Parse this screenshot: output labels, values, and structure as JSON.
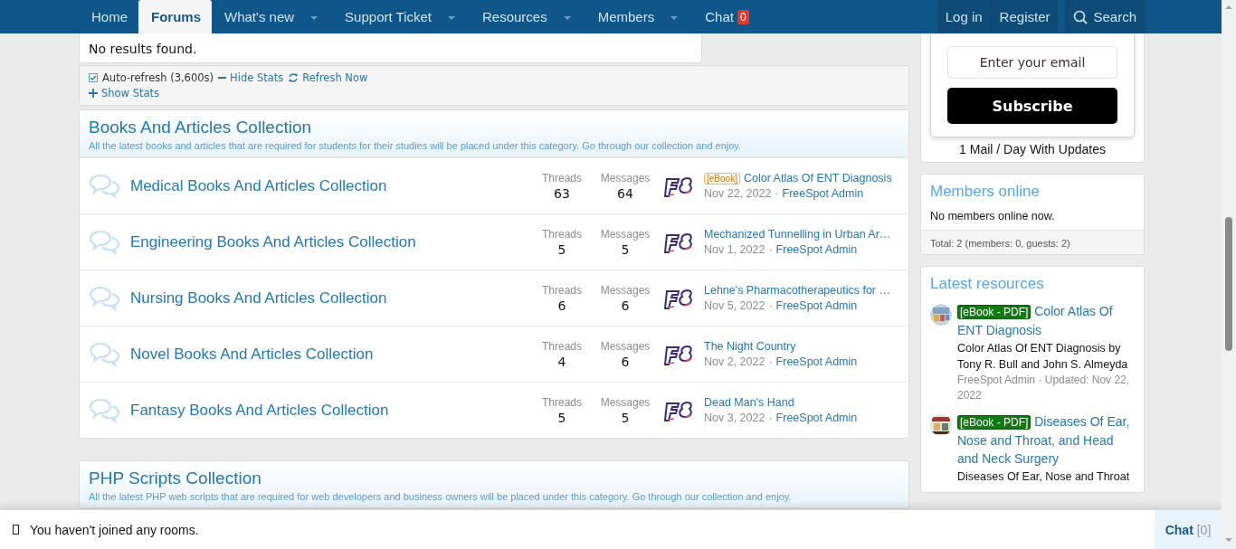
{
  "nav": {
    "tabs": [
      {
        "label": "Home",
        "selected": false,
        "dropdown": false
      },
      {
        "label": "Forums",
        "selected": true,
        "dropdown": false
      },
      {
        "label": "What's new",
        "selected": false,
        "dropdown": true
      },
      {
        "label": "Support Ticket",
        "selected": false,
        "dropdown": true
      },
      {
        "label": "Resources",
        "selected": false,
        "dropdown": true
      },
      {
        "label": "Members",
        "selected": false,
        "dropdown": true
      },
      {
        "label": "Chat",
        "selected": false,
        "dropdown": false,
        "badge": "0"
      }
    ],
    "account": [
      "Log in",
      "Register"
    ],
    "search": "Search"
  },
  "results": "No results found.",
  "stats": {
    "auto_refresh": {
      "label": "Auto-refresh (3,600s)",
      "checked": true
    },
    "hide": "Hide Stats",
    "refresh": "Refresh Now",
    "show": "Show Stats"
  },
  "categories": [
    {
      "title": "Books And Articles Collection",
      "description": "All the latest books and articles that are required for students for their studies will be placed under this category. Go through our collection and enjoy.",
      "forums": [
        {
          "name": "Medical Books And Articles Collection",
          "threads_label": "Threads",
          "threads": "63",
          "messages_label": "Messages",
          "messages": "64",
          "prefix": "[eBook]",
          "latest": "Color Atlas Of ENT Diagnosis",
          "date": "Nov 22, 2022",
          "separator": "·",
          "author": "FreeSpot Admin"
        },
        {
          "name": "Engineering Books And Articles Collection",
          "threads_label": "Threads",
          "threads": "5",
          "messages_label": "Messages",
          "messages": "5",
          "latest": "Mechanized Tunnelling in Urban Ar…",
          "date": "Nov 1, 2022",
          "separator": "·",
          "author": "FreeSpot Admin"
        },
        {
          "name": "Nursing Books And Articles Collection",
          "threads_label": "Threads",
          "threads": "6",
          "messages_label": "Messages",
          "messages": "6",
          "latest": "Lehne's Pharmacotherapeutics for …",
          "date": "Nov 5, 2022",
          "separator": "·",
          "author": "FreeSpot Admin"
        },
        {
          "name": "Novel Books And Articles Collection",
          "threads_label": "Threads",
          "threads": "4",
          "messages_label": "Messages",
          "messages": "6",
          "latest": "The Night Country",
          "date": "Nov 2, 2022",
          "separator": "·",
          "author": "FreeSpot Admin"
        },
        {
          "name": "Fantasy Books And Articles Collection",
          "threads_label": "Threads",
          "threads": "5",
          "messages_label": "Messages",
          "messages": "5",
          "latest": "Dead Man's Hand",
          "date": "Nov 3, 2022",
          "separator": "·",
          "author": "FreeSpot Admin"
        }
      ]
    },
    {
      "title": "PHP Scripts Collection",
      "description": "All the latest PHP web scripts that are required for web developers and business owners will be placed under this category. Go through our collection and enjoy."
    }
  ],
  "sidebar": {
    "subscribe": {
      "placeholder": "Enter your email",
      "button": "Subscribe",
      "note": "1 Mail / Day With Updates"
    },
    "members_online": {
      "title": "Members online",
      "text": "No members online now.",
      "total": "Total: 2 (members: 0, guests: 2)"
    },
    "latest_resources": {
      "title": "Latest resources",
      "items": [
        {
          "tag": "[eBook - PDF]",
          "title": "Color Atlas Of ENT Diagnosis",
          "description": "Color Atlas Of ENT Diagnosis by Tony R. Bull and John S. Almeyda",
          "meta": "FreeSpot Admin · Updated: Nov 22, 2022"
        },
        {
          "tag": "[eBook - PDF]",
          "title": "Diseases Of Ear, Nose and Throat, and Head and Neck Surgery",
          "description": "Diseases Of Ear, Nose and Throat"
        }
      ]
    }
  },
  "chat_bar": {
    "message": "You haven't joined any rooms.",
    "button": "Chat",
    "count": "[0]"
  }
}
